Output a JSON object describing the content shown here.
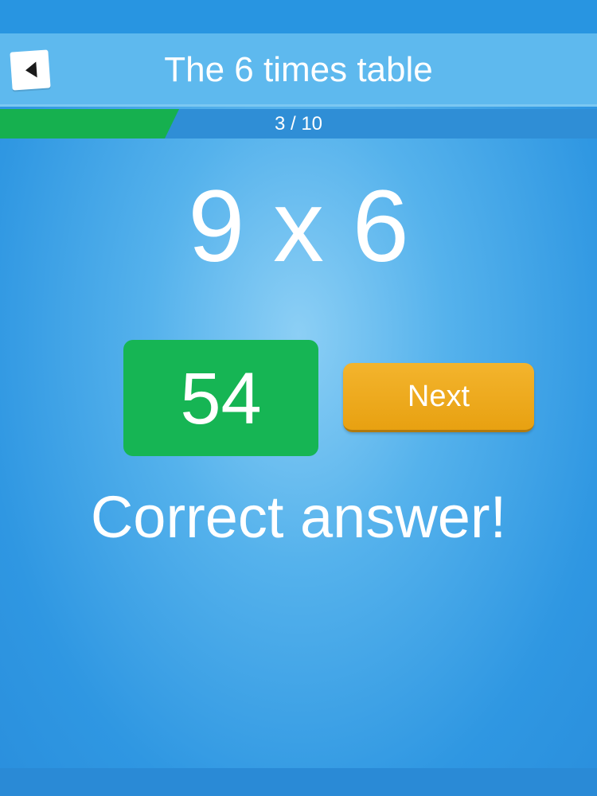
{
  "header": {
    "title": "The 6 times table",
    "back_icon": "back-arrow-icon"
  },
  "progress": {
    "label": "3 / 10",
    "current": 3,
    "total": 10,
    "fraction": 0.3
  },
  "quiz": {
    "question": "9 x 6",
    "answer": "54",
    "feedback": "Correct answer!",
    "next_label": "Next"
  },
  "colors": {
    "background": "#3a9fe4",
    "header": "#5eb9ee",
    "progress_fill": "#16b04f",
    "answer_correct": "#16b554",
    "next_button": "#eeaa1c"
  }
}
